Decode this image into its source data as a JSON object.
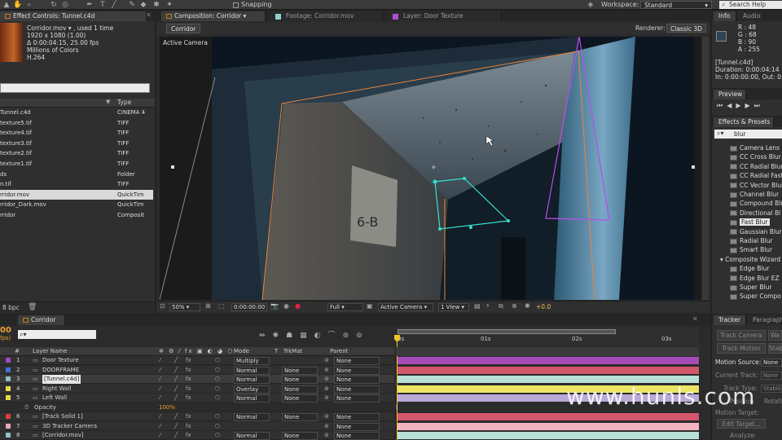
{
  "toolbar": {
    "snapping_label": "Snapping",
    "workspace_label": "Workspace:",
    "workspace_value": "Standard",
    "search_placeholder": "Search Help"
  },
  "effect_controls": {
    "tab_label": "Effect Controls: Tunnel.c4d"
  },
  "project": {
    "file_name": "Corridor.mov ▾ , used 1 time",
    "info_lines": [
      "1920 x 1080 (1.00)",
      "Δ 0:00:04:15, 25.00 fps",
      "Millions of Colors",
      "H.264"
    ],
    "col_type": "Type",
    "items": [
      {
        "name": "Tunnel.c4d",
        "type": "CINEMA 4"
      },
      {
        "name": "texture5.tif",
        "type": "TIFF"
      },
      {
        "name": "texture4.tif",
        "type": "TIFF"
      },
      {
        "name": "texture3.tif",
        "type": "TIFF"
      },
      {
        "name": "texture2.tif",
        "type": "TIFF"
      },
      {
        "name": "texture1.tif",
        "type": "TIFF"
      },
      {
        "name": "ds",
        "type": "Folder"
      },
      {
        "name": "n.tif",
        "type": "TIFF"
      },
      {
        "name": "rridor.mov",
        "type": "QuickTim"
      },
      {
        "name": "rridor_Dark.mov",
        "type": "QuickTim"
      },
      {
        "name": "rridor",
        "type": "Composit"
      }
    ],
    "bpc_label": "8 bpc"
  },
  "composition": {
    "tabs": [
      "Composition: Corridor",
      "Footage: Corridor.mov",
      "Layer: Door Texture"
    ],
    "sub_tab": "Corridor",
    "renderer_label": "Renderer:",
    "renderer_value": "Classic 3D",
    "active_camera": "Active Camera",
    "zoom": "50%",
    "timecode": "0:00:00:00",
    "resolution": "Full",
    "camera_view": "Active Camera",
    "views": "1 View",
    "exposure": "+0.0"
  },
  "info": {
    "tabs": [
      "Info",
      "Audio"
    ],
    "r": "R : 48",
    "g": "G : 68",
    "b": "B : 90",
    "a": "A : 255",
    "layer_name": "[Tunnel.c4d]",
    "duration": "Duration: 0:00:04:14",
    "in_out": "In: 0:00:00:00, Out: 0:0",
    "color_hex": "#304458"
  },
  "preview": {
    "tab_label": "Preview"
  },
  "effects_presets": {
    "tab_label": "Effects & Presets",
    "search_value": "blur",
    "group1_items": [
      "Camera Lens Bl",
      "CC Cross Blur",
      "CC Radial Blur",
      "CC Radial Fast",
      "CC Vector Blur",
      "Channel Blur",
      "Compound Blu",
      "Directional Bl",
      "Fast Blur",
      "Gaussian Blur",
      "Radial Blur",
      "Smart Blur"
    ],
    "group2_name": "Composite Wizard",
    "group2_items": [
      "Edge Blur",
      "Edge Blur EZ",
      "Super Blur",
      "Super Compo"
    ]
  },
  "tracker": {
    "tabs": [
      "Tracker",
      "Paragraph"
    ],
    "track_camera": "Track Camera",
    "warp": "Wa",
    "track_motion": "Track Motion",
    "stab": "Stab",
    "motion_source_label": "Motion Source:",
    "motion_source_value": "None",
    "current_track": "Current Track:",
    "current_track_value": "None",
    "track_type": "Track Type:",
    "track_type_value": "Stabiliz",
    "position": "Position",
    "rotation": "Rotatio",
    "motion_target": "Motion Target:",
    "edit_target": "Edit Target...",
    "analyze": "Analyze:"
  },
  "timeline": {
    "tab_label": "Corridor",
    "timecode": "00",
    "fps": "fps)",
    "col_num": "#",
    "col_name": "Layer Name",
    "col_mode": "Mode",
    "col_t": "T",
    "col_trkmat": "TrkMat",
    "col_parent": "Parent",
    "ruler": [
      "0s",
      "01s",
      "02s",
      "03s"
    ],
    "layers": [
      {
        "num": "1",
        "name": "Door Texture",
        "mode": "Multiply",
        "trkmat": "",
        "parent": "None",
        "color": "#a349c7",
        "bar": "#a64bb8",
        "sel": false
      },
      {
        "num": "2",
        "name": "DOORFRAME",
        "mode": "Normal",
        "trkmat": "None",
        "parent": "None",
        "color": "#3f6fdc",
        "bar": "#d3576a",
        "sel": false
      },
      {
        "num": "3",
        "name": "[Tunnel.c4d]",
        "mode": "Normal",
        "trkmat": "None",
        "parent": "None",
        "color": "#8fc1c3",
        "bar": "#b8e0d9",
        "sel": true
      },
      {
        "num": "4",
        "name": "Right Wall",
        "mode": "Overlay",
        "trkmat": "None",
        "parent": "None",
        "color": "#e6da4c",
        "bar": "#ece464",
        "sel": false
      },
      {
        "num": "5",
        "name": "Left Wall",
        "mode": "Normal",
        "trkmat": "None",
        "parent": "None",
        "color": "#e6da4c",
        "bar": "#b8a9d9",
        "sel": false
      },
      {
        "num": "",
        "name": "Opacity",
        "mode": "100%",
        "trkmat": "",
        "parent": "",
        "color": "",
        "bar": "",
        "sel": false
      },
      {
        "num": "6",
        "name": "[Track Solid 1]",
        "mode": "Normal",
        "trkmat": "None",
        "parent": "None",
        "color": "#e03d3d",
        "bar": "#d3576a",
        "sel": false
      },
      {
        "num": "7",
        "name": "3D Tracker Camera",
        "mode": "",
        "trkmat": "",
        "parent": "None",
        "color": "#e9a6b8",
        "bar": "#f2b3c1",
        "sel": false
      },
      {
        "num": "8",
        "name": "[Corridor.mov]",
        "mode": "Normal",
        "trkmat": "None",
        "parent": "None",
        "color": "#8fc1c3",
        "bar": "#b8e0d9",
        "sel": false
      }
    ]
  },
  "sign_text": "6-B",
  "watermark": "www.hunls.com"
}
